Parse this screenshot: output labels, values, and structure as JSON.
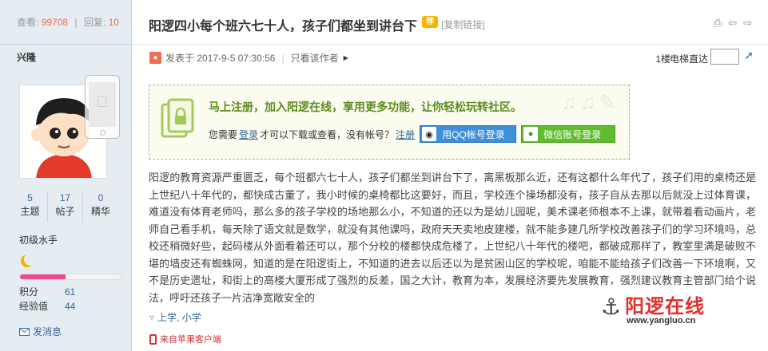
{
  "sidebar": {
    "views_label": "查看:",
    "views_value": "99708",
    "replies_label": "回复:",
    "replies_value": "10",
    "author": "兴隆",
    "stats": [
      {
        "value": "5",
        "label": "主题"
      },
      {
        "value": "17",
        "label": "帖子"
      },
      {
        "value": "0",
        "label": "精华"
      }
    ],
    "level": "初级水手",
    "level_progress": 0.45,
    "points_label": "积分",
    "points_value": "61",
    "exp_label": "经验值",
    "exp_value": "44",
    "send_message": "发消息"
  },
  "post": {
    "title": "阳逻四小每个班六七十人，孩子们都坐到讲台下",
    "title_badge": "荐",
    "copy_link": "[复制链接]",
    "posted_prefix": "发表于",
    "posted_time": "2017-9-5 07:30:56",
    "author_only": "只看该作者",
    "floor": "1楼",
    "elevator": "电梯直达",
    "notice_head": "马上注册，加入阳逻在线，享用更多功能，让你轻松玩转社区。",
    "notice_pre": "您需要",
    "notice_login": "登录",
    "notice_mid": "才可以下载或查看，没有帐号？",
    "notice_register": "注册",
    "qq_login": "用QQ帐号登录",
    "wx_login": "微信账号登录",
    "body": "阳逻的教育资源严重匮乏，每个班都六七十人，孩子们都坐到讲台下了，离黑板那么近，还有这都什么年代了，孩子们用的桌椅还是上世纪八十年代的，都快成古董了，我小时候的桌椅都比这要好，而且，学校连个操场都没有，孩子自从去那以后就没上过体育课，难道没有体育老师吗，那么多的孩子学校的场地那么小，不知道的还以为是幼儿园呢，美术课老师根本不上课，就带着看动画片，老师自己看手机，每天除了语文就是数学，就没有其他课吗，政府天天卖地皮建楼，就不能多建几所学校改善孩子们的学习环境吗，总校还稍微好些，起码楼从外面看着还可以，那个分校的楼都快成危楼了，上世纪八十年代的楼吧，都破成那样了，教室里满是破败不堪的墙皮还有蜘蛛网，知道的是在阳逻街上，不知道的进去以后还以为是贫困山区的学校呢，咱能不能给孩子们改善一下环境啊，又不是历史遗址，和街上的高楼大厦形成了强烈的反差，国之大计，教育为本，发展经济要先发展教育，强烈建议教育主管部门给个说法，呼吁还孩子一片洁净宽敞安全的",
    "tags": "上学, 小学",
    "source": "来自苹果客户端"
  },
  "watermark": {
    "brand": "阳逻在线",
    "url": "www.yangluo.cn"
  },
  "colors": {
    "accent_red": "#f26c4f",
    "link_blue": "#336699",
    "sidebar_bg": "#e5edf2",
    "notice_green": "#5d8b1c",
    "qq_blue": "#3d8fd9",
    "wechat_green": "#5fbd2d",
    "progress_pink": "#ec4b8d"
  },
  "icons": [
    "apple-phone-icon",
    "moon-icon",
    "mail-icon",
    "print-icon",
    "prev-icon",
    "next-icon",
    "person-icon",
    "go-icon",
    "tag-icon",
    "phone-icon",
    "qq-icon",
    "wechat-icon",
    "lock-doc-icon",
    "anchor-icon"
  ]
}
